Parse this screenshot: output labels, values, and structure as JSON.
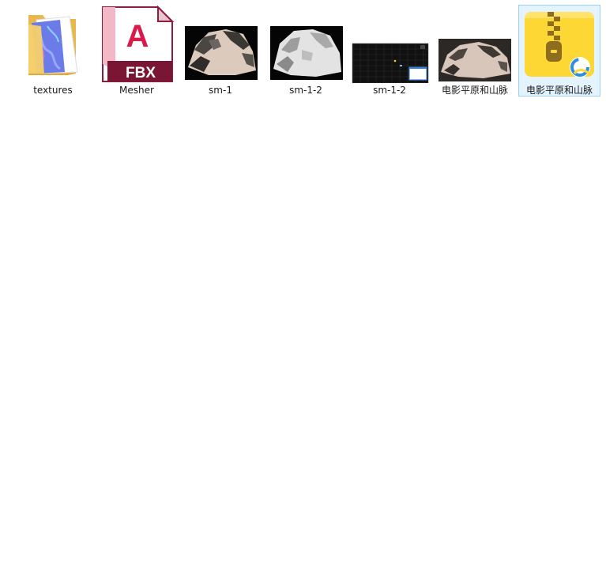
{
  "explorer": {
    "items": [
      {
        "label": "textures",
        "type": "folder",
        "icon": "folder-icon"
      },
      {
        "label": "Mesher",
        "type": "fbx",
        "icon": "fbx-file-icon",
        "badge": "FBX",
        "brand_letter": "A"
      },
      {
        "label": "sm-1",
        "type": "image",
        "icon": "terrain-render-thumbnail"
      },
      {
        "label": "sm-1-2",
        "type": "image",
        "icon": "terrain-render-thumbnail"
      },
      {
        "label": "sm-1-2",
        "type": "image",
        "icon": "editor-screenshot-thumbnail"
      },
      {
        "label": "电影平原和山脉",
        "type": "image",
        "icon": "terrain-render-thumbnail"
      },
      {
        "label": "电影平原和山脉",
        "type": "archive",
        "icon": "zip-archive-icon",
        "selected": true
      }
    ]
  },
  "colors": {
    "selection_bg": "#e5f3ff",
    "selection_border": "#99d1ff",
    "fbx_brand": "#b31a47",
    "folder": "#f5c94c",
    "zip_yellow": "#fdd835"
  }
}
